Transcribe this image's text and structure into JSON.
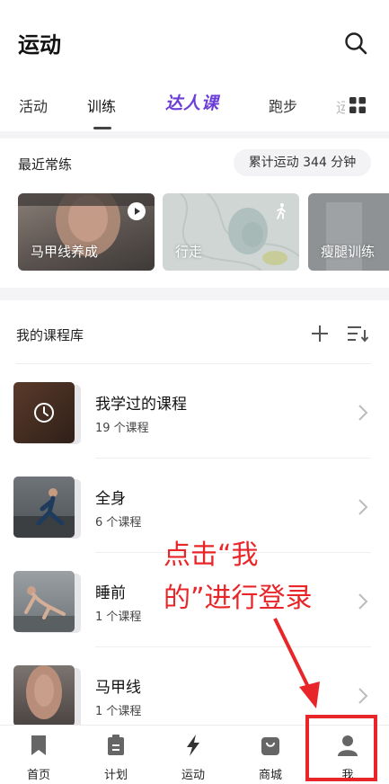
{
  "header": {
    "title": "运动"
  },
  "tabs": [
    {
      "label": "活动"
    },
    {
      "label": "训练"
    },
    {
      "label": "达人课"
    },
    {
      "label": "跑步"
    },
    {
      "label": "运"
    }
  ],
  "recent": {
    "title": "最近常练",
    "total": "累计运动 344 分钟",
    "cards": [
      {
        "label": "马甲线养成"
      },
      {
        "label": "行走"
      },
      {
        "label": "瘦腿训练"
      }
    ]
  },
  "library": {
    "title": "我的课程库",
    "courses": [
      {
        "name": "我学过的课程",
        "count": "19 个课程"
      },
      {
        "name": "全身",
        "count": "6 个课程"
      },
      {
        "name": "睡前",
        "count": "1 个课程"
      },
      {
        "name": "马甲线",
        "count": "1 个课程"
      }
    ]
  },
  "annotation": {
    "line1": "点击“我",
    "line2": "的”进行登录"
  },
  "tabbar": [
    {
      "label": "首页",
      "icon": "bookmark-icon"
    },
    {
      "label": "计划",
      "icon": "clipboard-icon"
    },
    {
      "label": "运动",
      "icon": "lightning-icon"
    },
    {
      "label": "商城",
      "icon": "shopping-bag-icon"
    },
    {
      "label": "我",
      "icon": "person-icon"
    }
  ],
  "colors": {
    "accent_purple": "#6b3fd6",
    "annotation_red": "#e8262a"
  }
}
